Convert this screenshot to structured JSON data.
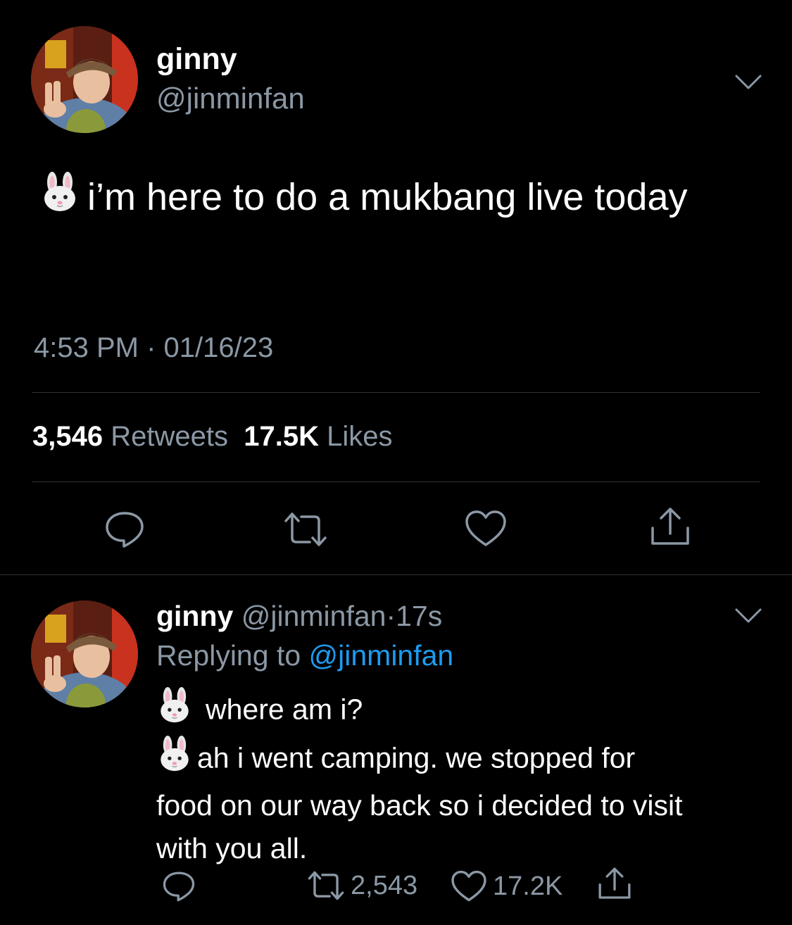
{
  "main_tweet": {
    "author": {
      "display_name": "ginny",
      "handle": "@jinminfan",
      "avatar": "profile-photo"
    },
    "text": "i’m here to do a mukbang live today",
    "emoji": "rabbit-face",
    "timestamp": "4:53 PM · 01/16/23",
    "retweets_count": "3,546",
    "retweets_label": "Retweets",
    "likes_count": "17.5K",
    "likes_label": "Likes",
    "actions": [
      "reply-icon",
      "retweet-icon",
      "like-icon",
      "share-icon"
    ]
  },
  "reply_tweet": {
    "author": {
      "display_name": "ginny",
      "handle": "@jinminfan",
      "avatar": "profile-photo"
    },
    "separator": "·",
    "age": "17s",
    "replying_label": "Replying to",
    "replying_to": "@jinminfan",
    "lines": [
      "where am i?",
      "ah i went camping. we stopped for",
      "food on our way back so i decided to visit",
      "with you all."
    ],
    "retweets_count": "2,543",
    "likes_count": "17.2K"
  },
  "colors": {
    "background": "#000000",
    "primary_text": "#ffffff",
    "secondary_text": "#8b98a5",
    "link": "#1d9bf0",
    "divider": "#2f3336"
  }
}
